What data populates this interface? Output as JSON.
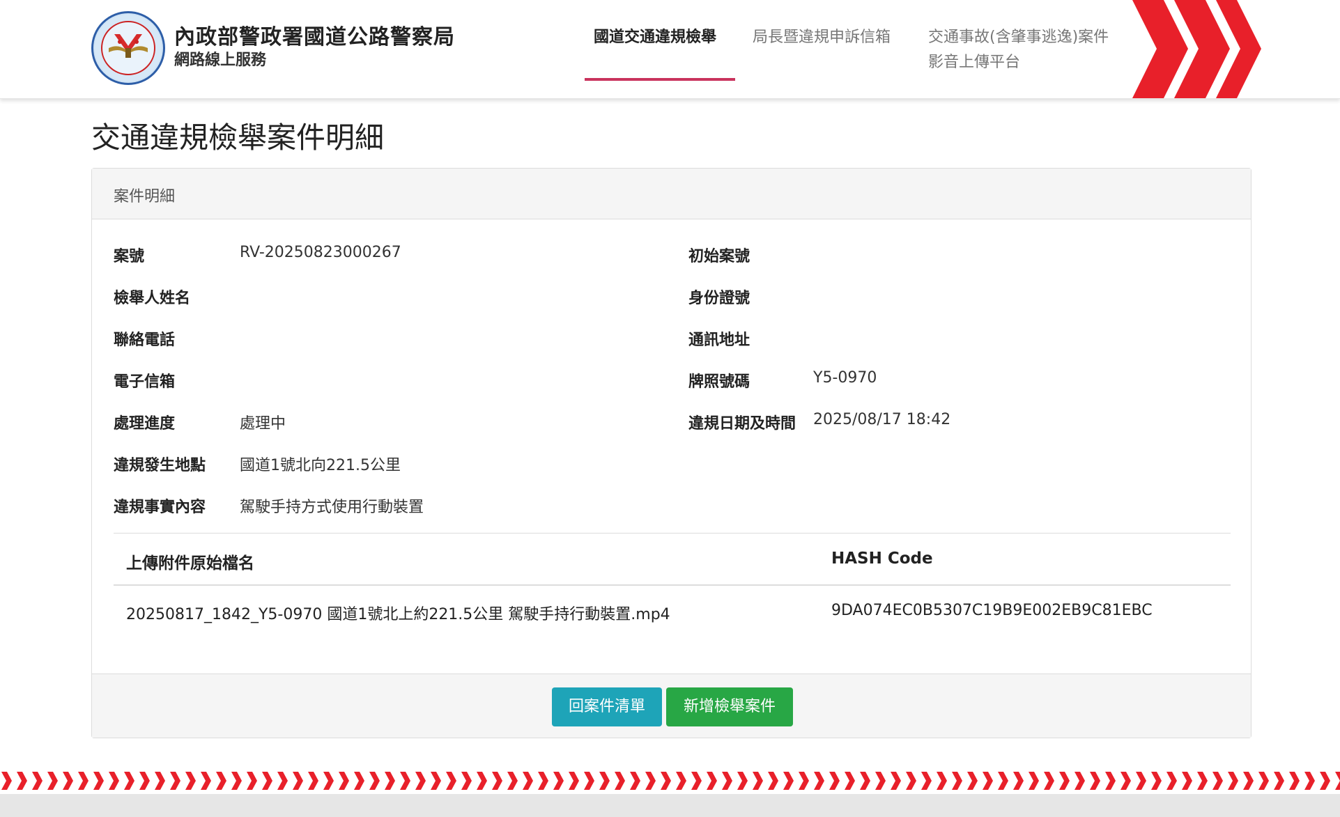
{
  "header": {
    "agency_name": "內政部警政署國道公路警察局",
    "agency_sub": "網路線上服務",
    "nav": [
      {
        "label": "國道交通違規檢舉",
        "active": true
      },
      {
        "label": "局長暨違規申訴信箱",
        "active": false
      },
      {
        "label_line1": "交通事故(含肇事逃逸)案件",
        "label_line2": "影音上傳平台",
        "active": false
      }
    ],
    "accent_color": "#c9335d",
    "brand_red": "#e8202a"
  },
  "page_title": "交通違規檢舉案件明細",
  "card": {
    "header": "案件明細",
    "fields": {
      "case_no": {
        "label": "案號",
        "value": "RV-20250823000267"
      },
      "orig_case_no": {
        "label": "初始案號",
        "value": ""
      },
      "reporter_name": {
        "label": "檢舉人姓名",
        "value": ""
      },
      "id_no": {
        "label": "身份證號",
        "value": ""
      },
      "phone": {
        "label": "聯絡電話",
        "value": ""
      },
      "address": {
        "label": "通訊地址",
        "value": ""
      },
      "email": {
        "label": "電子信箱",
        "value": ""
      },
      "plate": {
        "label": "牌照號碼",
        "value": "Y5-0970"
      },
      "status": {
        "label": "處理進度",
        "value": "處理中"
      },
      "datetime": {
        "label": "違規日期及時間",
        "value": "2025/08/17 18:42"
      },
      "location": {
        "label": "違規發生地點",
        "value": "國道1號北向221.5公里"
      },
      "facts": {
        "label": "違規事實內容",
        "value": "駕駛手持方式使用行動裝置"
      }
    },
    "attachments": {
      "columns": [
        "上傳附件原始檔名",
        "HASH Code"
      ],
      "rows": [
        [
          "20250817_1842_Y5-0970 國道1號北上約221.5公里 駕駛手持行動裝置.mp4",
          "9DA074EC0B5307C19B9E002EB9C81EBC"
        ]
      ]
    },
    "buttons": {
      "back": "回案件清單",
      "new": "新增檢舉案件"
    },
    "button_colors": {
      "back": "#1ea4b8",
      "new": "#28a745"
    }
  }
}
